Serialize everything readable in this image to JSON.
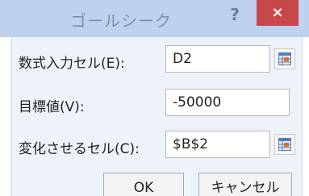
{
  "dialog": {
    "title": "ゴールシーク",
    "help_symbol": "?",
    "close_symbol": "×"
  },
  "fields": {
    "formula_cell": {
      "label": "数式入力セル(E):",
      "value": "D2",
      "icon": "range-select-icon"
    },
    "target_value": {
      "label": "目標値(V):",
      "value": "-50000"
    },
    "changing_cell": {
      "label": "変化させるセル(C):",
      "value": "$B$2",
      "icon": "range-select-icon"
    }
  },
  "buttons": {
    "ok": "OK",
    "cancel": "キャンセル"
  },
  "colors": {
    "titlebar": "#bcd2ee",
    "close": "#c8474a",
    "background": "#eef3f9"
  }
}
